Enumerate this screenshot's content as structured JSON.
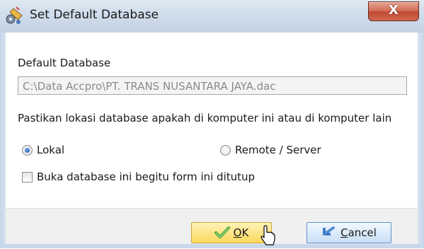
{
  "window": {
    "title": "Set Default Database",
    "close_label": "X"
  },
  "form": {
    "default_db_label": "Default Database",
    "db_path_value": "C:\\Data Accpro\\PT. TRANS NUSANTARA JAYA.dac",
    "location_prompt": "Pastikan lokasi database apakah di komputer ini atau di komputer lain",
    "radio_local_label": "Lokal",
    "radio_local_checked": true,
    "radio_remote_label": "Remote / Server",
    "radio_remote_checked": false,
    "open_on_close_label": "Buka database ini begitu form ini ditutup",
    "open_on_close_checked": false
  },
  "buttons": {
    "ok_mnemonic": "O",
    "ok_rest": "K",
    "cancel_mnemonic": "C",
    "cancel_rest": "ancel"
  },
  "colors": {
    "ok_icon": "#4aa53a",
    "cancel_icon": "#2f6fc4",
    "close_button": "#c24a33"
  },
  "icons": {
    "title": "database-settings-icon",
    "ok": "checkmark-icon",
    "cancel": "undo-arrow-icon",
    "cursor": "mouse-pointer-icon"
  }
}
